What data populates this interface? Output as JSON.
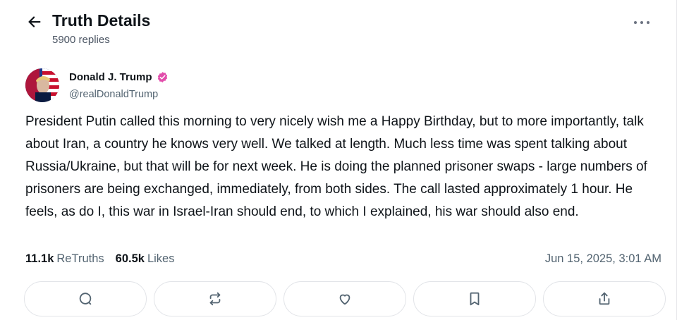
{
  "header": {
    "title": "Truth Details",
    "replies": "5900 replies"
  },
  "post": {
    "author_name": "Donald J. Trump",
    "author_handle": "@realDonaldTrump",
    "verified": true,
    "text": "President Putin called this morning to very nicely wish me a Happy Birthday, but to more importantly, talk about Iran, a country he knows very well. We talked at length. Much less time was spent talking about Russia/Ukraine, but that will be for next week. He is doing the planned prisoner swaps - large numbers of prisoners are being exchanged, immediately, from both sides. The call lasted approximately 1 hour. He feels, as do I, this war in Israel-Iran should end, to which I explained, his war should also end.",
    "retruths_count": "11.1k",
    "retruths_label": "ReTruths",
    "likes_count": "60.5k",
    "likes_label": "Likes",
    "timestamp": "Jun 15, 2025, 3:01 AM"
  },
  "actions": [
    {
      "name": "reply-button",
      "icon": "comment-icon"
    },
    {
      "name": "retruth-button",
      "icon": "repost-icon"
    },
    {
      "name": "like-button",
      "icon": "heart-icon"
    },
    {
      "name": "bookmark-button",
      "icon": "bookmark-icon"
    },
    {
      "name": "share-button",
      "icon": "share-icon"
    }
  ],
  "colors": {
    "verified_badge": "#e24dab",
    "text": "#0f1419",
    "muted": "#536471",
    "border": "#e2e4e8"
  }
}
